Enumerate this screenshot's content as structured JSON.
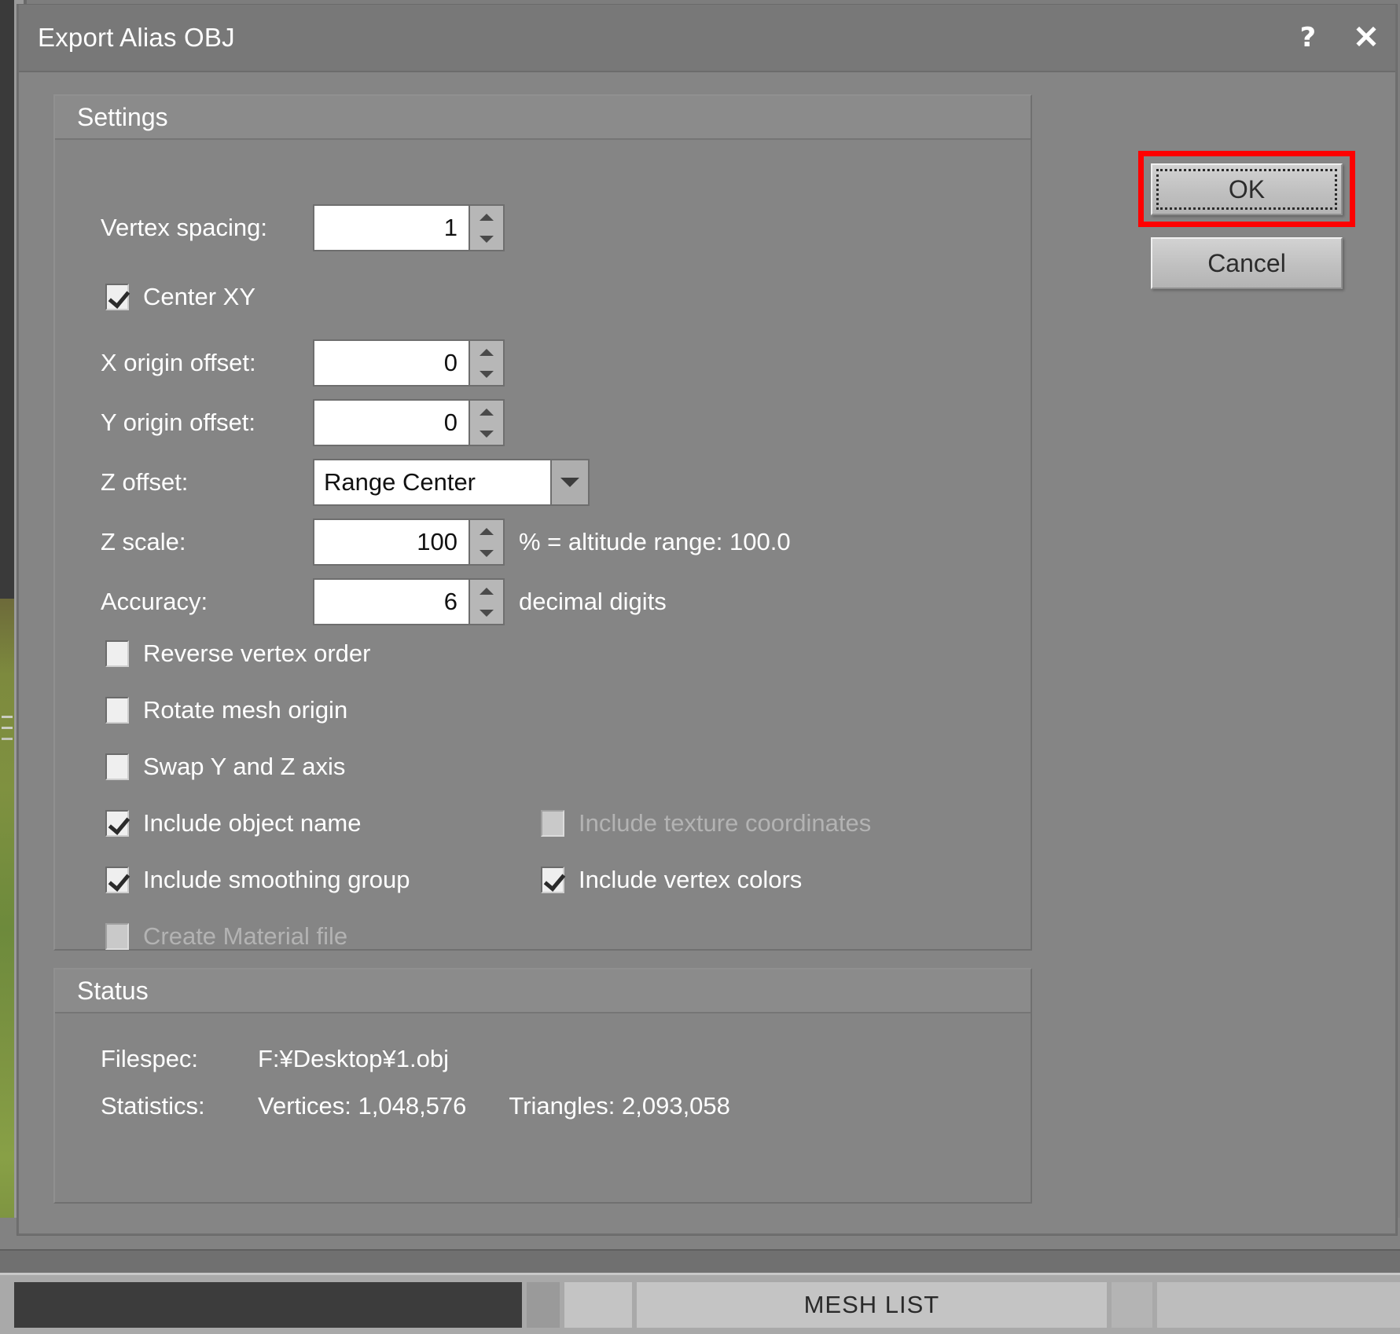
{
  "window": {
    "title": "Export Alias OBJ",
    "help_icon": "help-question-icon",
    "close_icon": "close-x-icon"
  },
  "buttons": {
    "ok_label": "OK",
    "cancel_label": "Cancel",
    "ok_highlight_color": "#ff0000"
  },
  "settings": {
    "group_title": "Settings",
    "vertex_spacing": {
      "label": "Vertex spacing:",
      "value": "1"
    },
    "center_xy": {
      "label": "Center XY",
      "checked": true
    },
    "x_origin_offset": {
      "label": "X origin offset:",
      "value": "0"
    },
    "y_origin_offset": {
      "label": "Y origin offset:",
      "value": "0"
    },
    "z_offset": {
      "label": "Z offset:",
      "value": "Range Center"
    },
    "z_scale": {
      "label": "Z scale:",
      "value": "100",
      "suffix": "% = altitude range: 100.0"
    },
    "accuracy": {
      "label": "Accuracy:",
      "value": "6",
      "suffix": "decimal digits"
    },
    "checkboxes": [
      {
        "label": "Reverse vertex order",
        "checked": false,
        "enabled": true
      },
      {
        "label": "Rotate mesh origin",
        "checked": false,
        "enabled": true
      },
      {
        "label": "Swap Y and Z axis",
        "checked": false,
        "enabled": true
      },
      {
        "label": "Include object name",
        "checked": true,
        "enabled": true
      },
      {
        "label": "Include smoothing group",
        "checked": true,
        "enabled": true
      },
      {
        "label": "Create Material file",
        "checked": false,
        "enabled": false
      }
    ],
    "checkboxes_right": [
      {
        "label": "Include texture coordinates",
        "checked": false,
        "enabled": false
      },
      {
        "label": "Include vertex colors",
        "checked": true,
        "enabled": true
      }
    ]
  },
  "status": {
    "group_title": "Status",
    "filespec_label": "Filespec:",
    "filespec_value": "F:¥Desktop¥1.obj",
    "statistics_label": "Statistics:",
    "vertices": "Vertices: 1,048,576",
    "triangles": "Triangles: 2,093,058"
  },
  "background": {
    "toolbar_label": "MESH LIST"
  }
}
